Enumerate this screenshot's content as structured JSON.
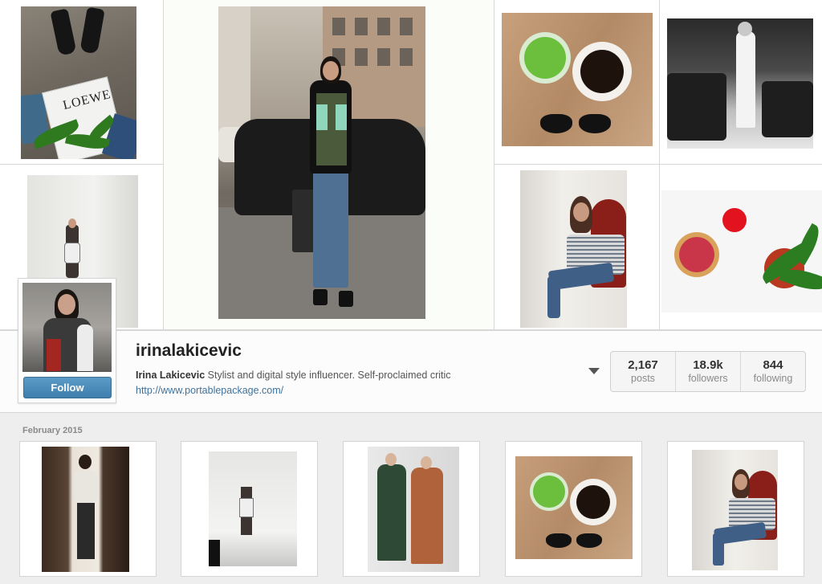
{
  "profile": {
    "username": "irinalakicevic",
    "full_name": "Irina Lakicevic",
    "bio": " Stylist and digital style influencer. Self-proclaimed critic",
    "website": "http://www.portablepackage.com/",
    "follow_label": "Follow"
  },
  "stats": [
    {
      "value": "2,167",
      "label": "posts"
    },
    {
      "value": "18.9k",
      "label": "followers"
    },
    {
      "value": "844",
      "label": "following"
    }
  ],
  "feed": {
    "month_label": "February 2015",
    "posts": [
      {
        "subject": "mirror-selfie"
      },
      {
        "subject": "woman-walking"
      },
      {
        "subject": "two-models"
      },
      {
        "subject": "matcha-and-coffee"
      },
      {
        "subject": "woman-on-chair"
      }
    ]
  },
  "colors": {
    "accent": "#3f729b",
    "follow_button": "#4a8bbb",
    "background": "#eeeeee"
  },
  "icons": {
    "options": "chevron-down-icon"
  }
}
